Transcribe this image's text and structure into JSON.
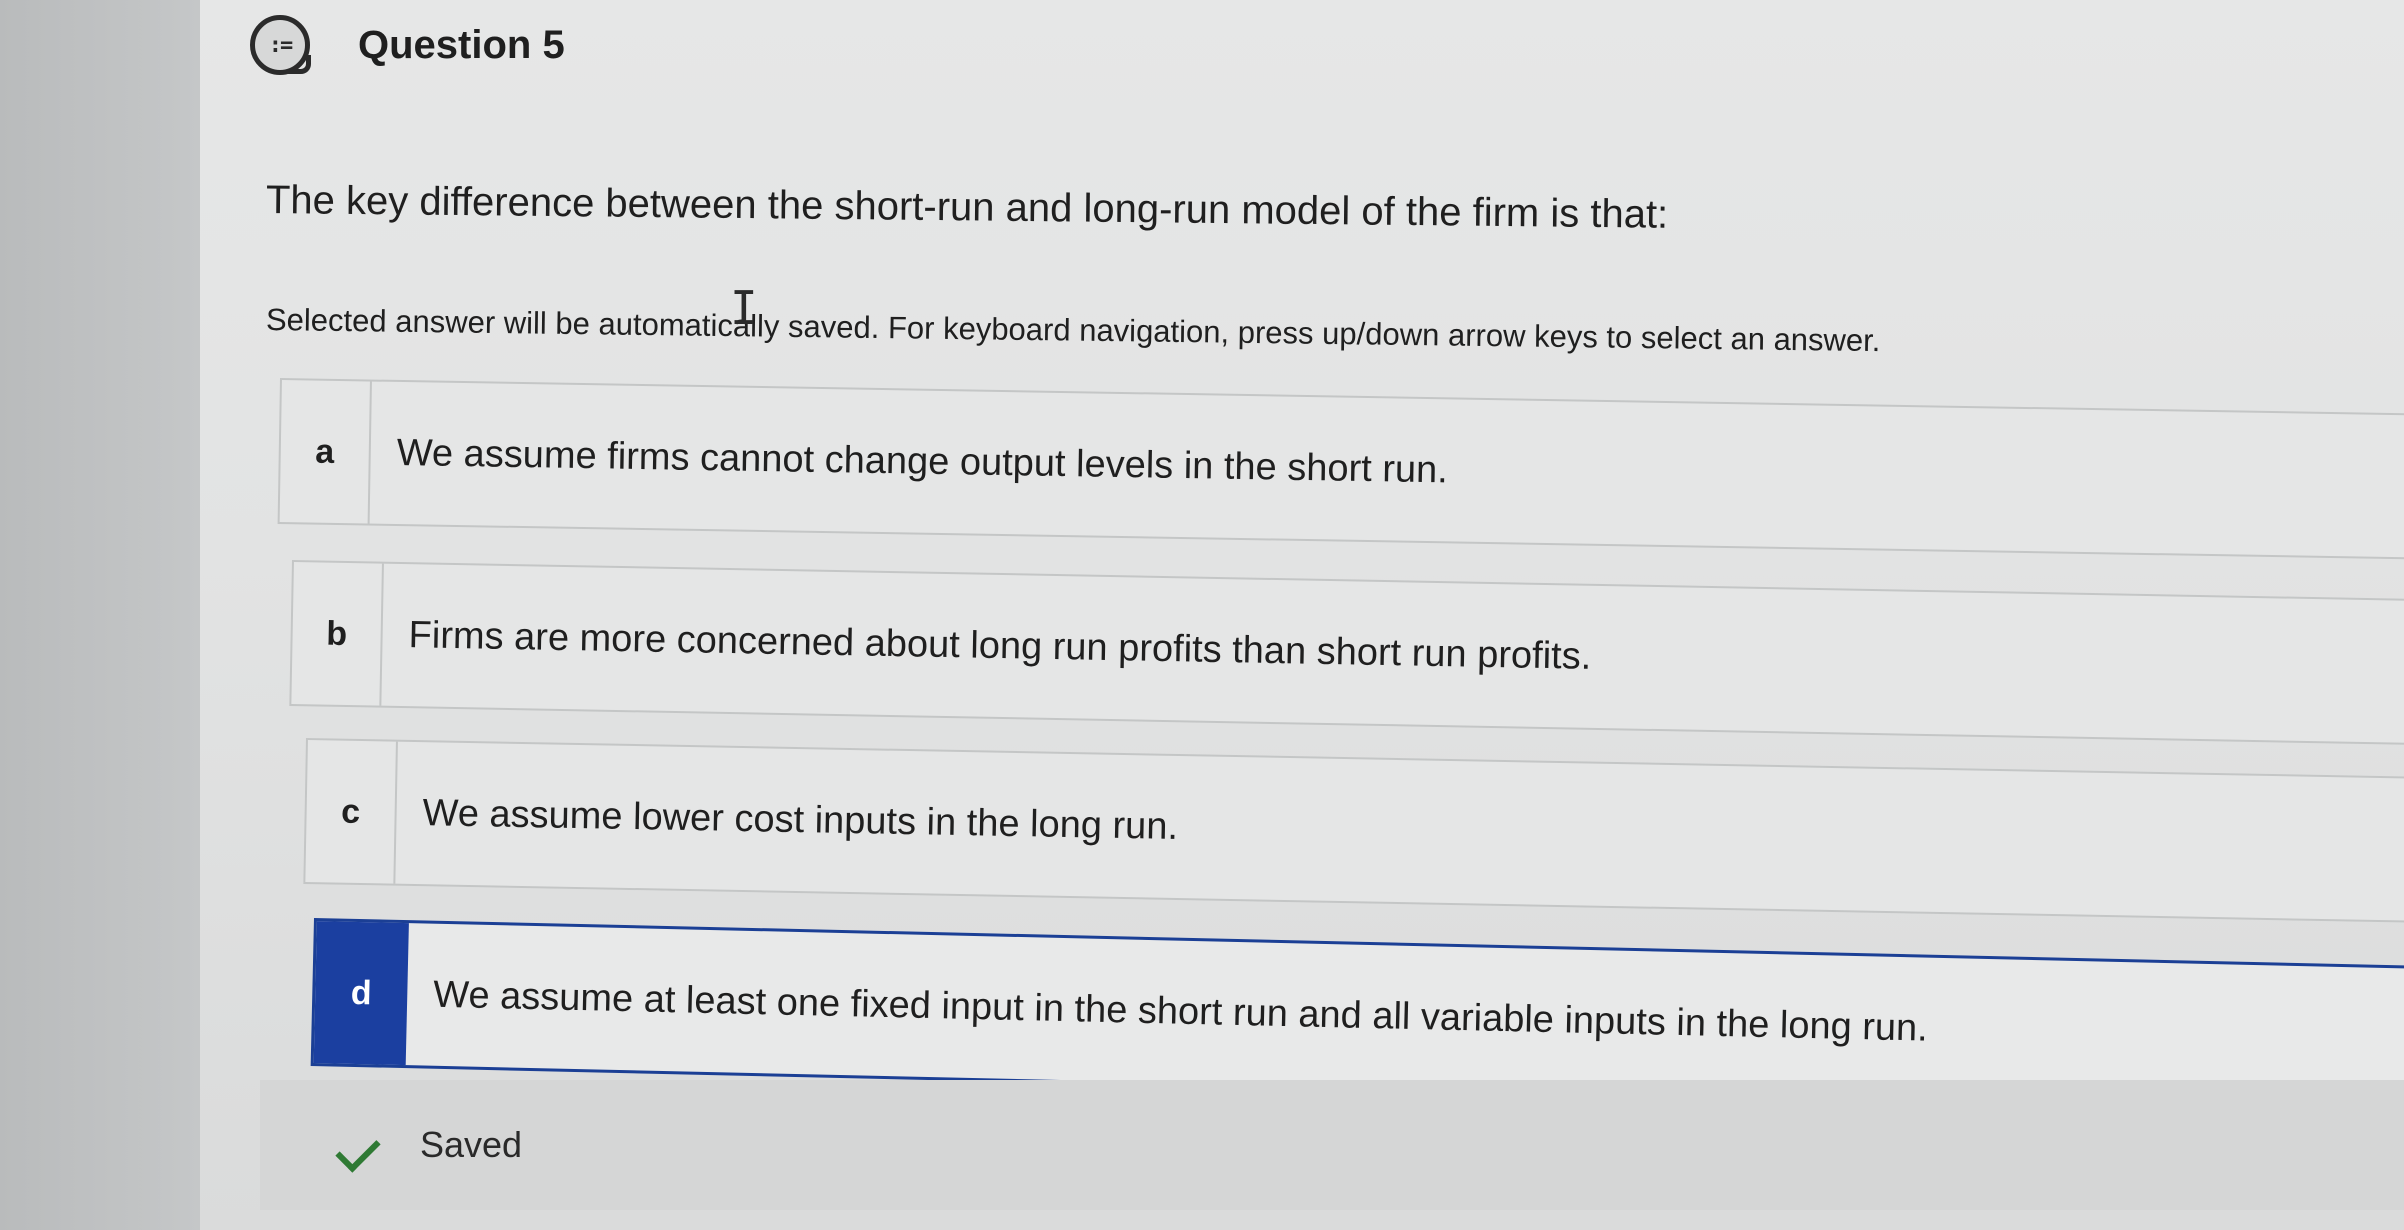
{
  "header": {
    "icon": "question-list-icon",
    "icon_glyph": ":=",
    "title": "Question 5"
  },
  "question": {
    "text": "The key difference between the short-run and long-run model of the firm is that:",
    "instruction": "Selected answer will be automatically saved. For keyboard navigation, press up/down arrow keys to select an answer."
  },
  "answers": [
    {
      "letter": "a",
      "text": "We assume firms cannot change output levels in the short run.",
      "selected": false
    },
    {
      "letter": "b",
      "text": "Firms are more concerned about long run profits than short run profits.",
      "selected": false
    },
    {
      "letter": "c",
      "text": "We assume lower cost inputs in the long run.",
      "selected": false
    },
    {
      "letter": "d",
      "text": "We assume at least one fixed input in the short run and all variable inputs in the long run.",
      "selected": true
    }
  ],
  "status": {
    "icon": "check-icon",
    "text": "Saved"
  },
  "colors": {
    "selected_accent": "#1b3fa0",
    "saved_check": "#2f7a34"
  }
}
